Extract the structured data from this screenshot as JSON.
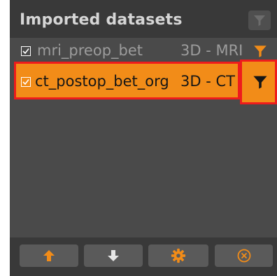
{
  "panel": {
    "title": "Imported datasets"
  },
  "datasets": [
    {
      "name": "mri_preop_bet",
      "type": "3D - MRI",
      "checked": true,
      "selected": false
    },
    {
      "name": "ct_postop_bet_org",
      "type": "3D - CT",
      "checked": true,
      "selected": true
    }
  ],
  "toolbar": {
    "move_up_icon": "arrow-up-icon",
    "move_down_icon": "arrow-down-icon",
    "settings_icon": "gear-icon",
    "remove_icon": "close-circle-icon"
  },
  "colors": {
    "accent": "#f28c18",
    "highlight": "#ee1c1c",
    "panel": "#4a4a4a",
    "header": "#393939"
  }
}
